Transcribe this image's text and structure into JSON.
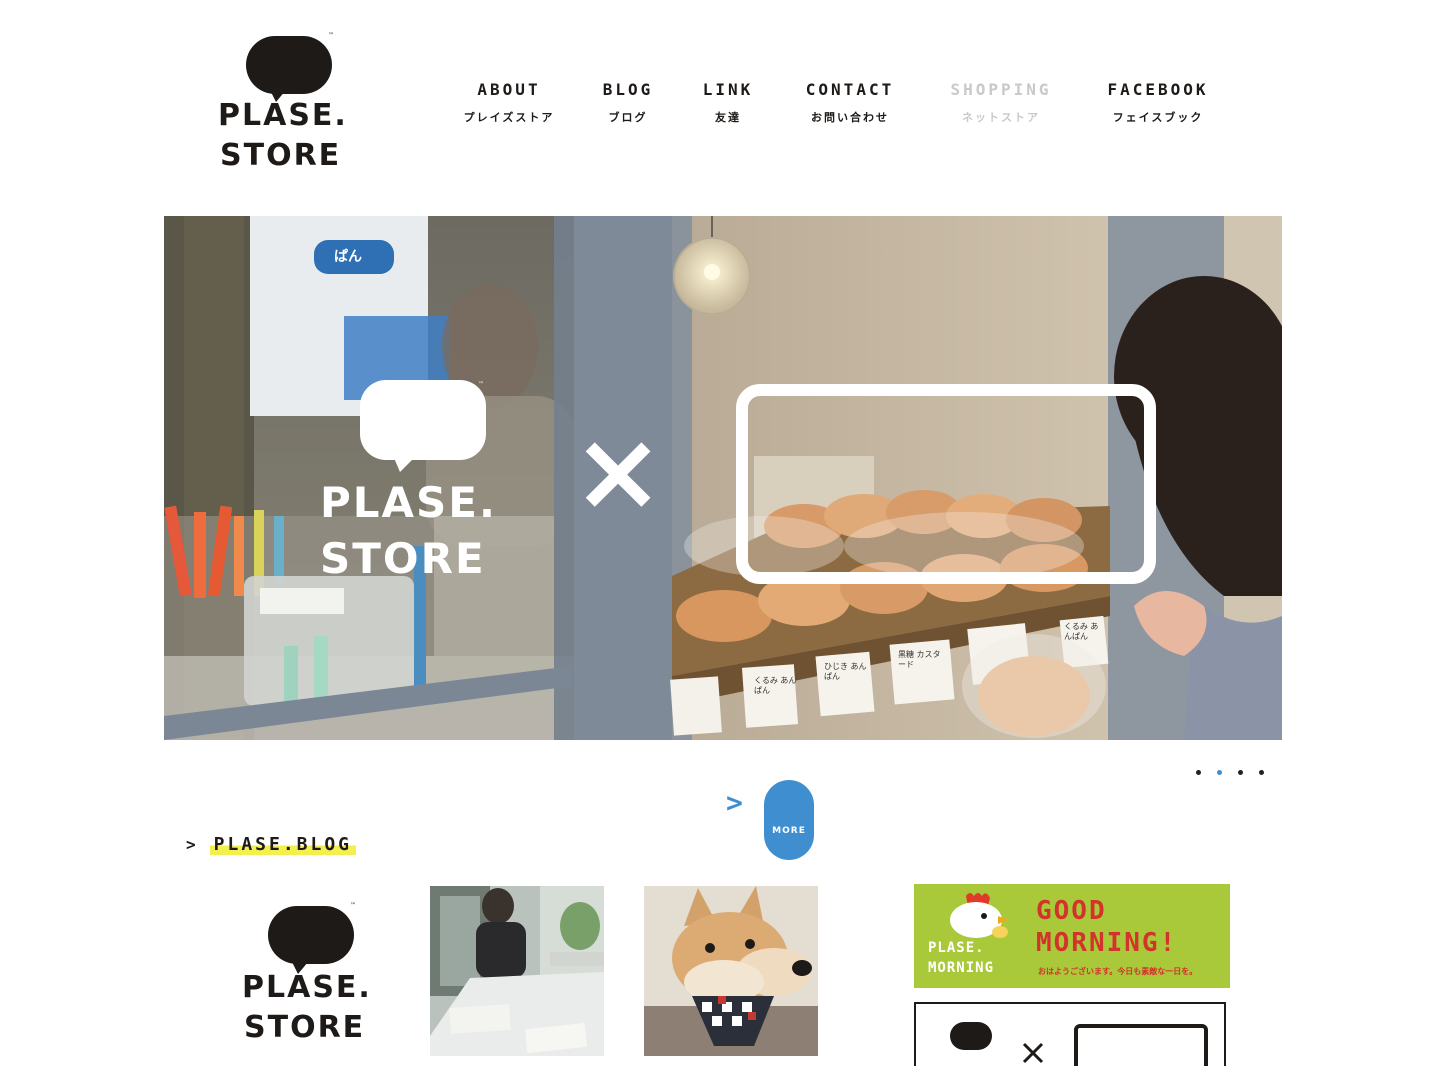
{
  "logo": {
    "line1": "PLASE.",
    "line2": "STORE",
    "tm": "™"
  },
  "nav": [
    {
      "en": "ABOUT",
      "ja": "プレイズストア"
    },
    {
      "en": "BLOG",
      "ja": "ブログ"
    },
    {
      "en": "LINK",
      "ja": "友達"
    },
    {
      "en": "CONTACT",
      "ja": "お問い合わせ"
    },
    {
      "en": "SHOPPING",
      "ja": "ネットストア"
    },
    {
      "en": "FACEBOOK",
      "ja": "フェイスブック"
    }
  ],
  "hero": {
    "logo_line1": "PLASE.",
    "logo_line2": "STORE",
    "cross": "×",
    "sign_text": "ぱん",
    "bread_labels": [
      "くるみ あんぱん",
      "ひじき あんぱん",
      "黒糖 カスタード",
      "くるみ あんぱん"
    ]
  },
  "slider": {
    "count": 4,
    "active_index": 1
  },
  "more": {
    "arrow": ">",
    "label": "MORE"
  },
  "blog": {
    "arrow": ">",
    "title": "PLASE.BLOG"
  },
  "thumb_logo": {
    "line1": "PLASE.",
    "line2": "STORE",
    "tm": "™"
  },
  "banner_morning": {
    "brand1": "PLASE.",
    "brand2": "MORNING",
    "headline1": "GOOD",
    "headline2": "MORNING!",
    "sub": "おはようございます。今日も素敵な一日を。"
  },
  "colors": {
    "accent_blue": "#3f8fd0",
    "highlight_yellow": "#f3ef4f",
    "banner_green": "#a9c93b",
    "banner_red": "#d2332a"
  }
}
